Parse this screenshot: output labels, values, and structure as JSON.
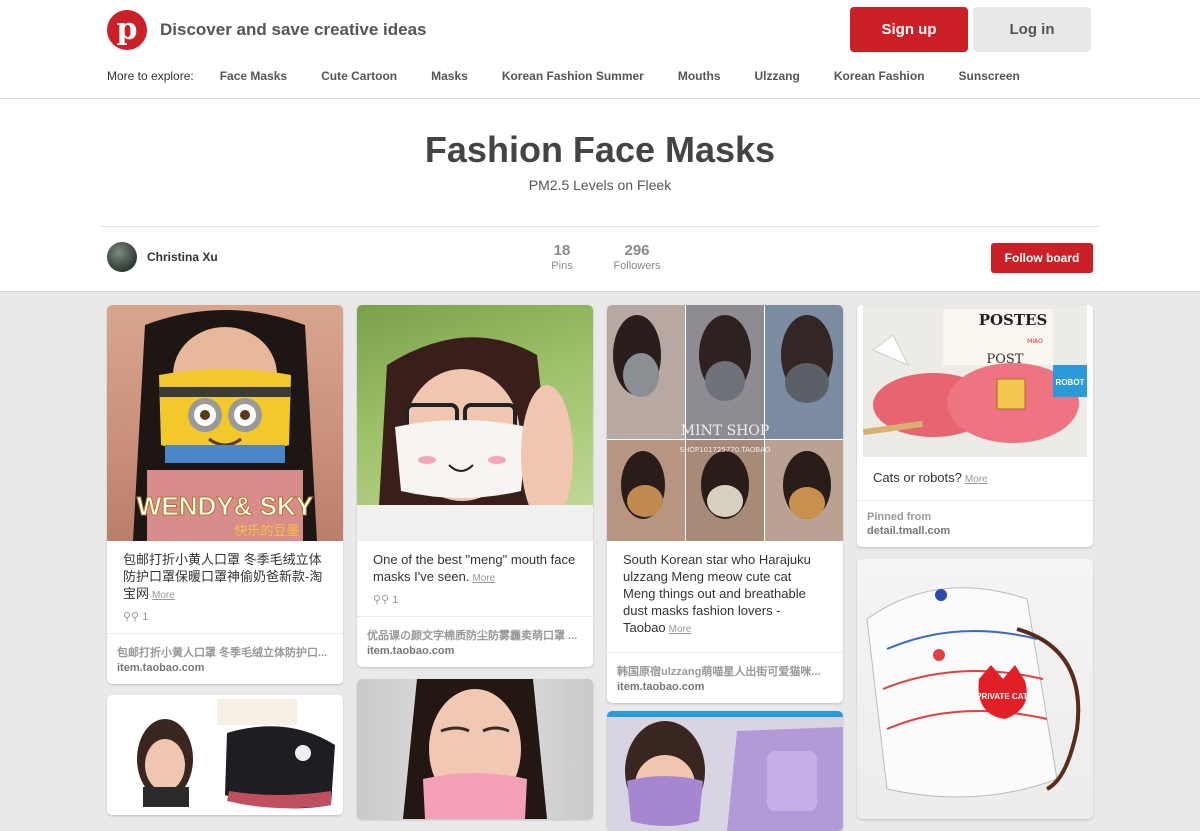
{
  "header": {
    "logo_letter": "p",
    "tagline": "Discover and save creative ideas",
    "signup_label": "Sign up",
    "login_label": "Log in",
    "explore_label": "More to explore:",
    "explore_links": [
      "Face Masks",
      "Cute Cartoon",
      "Masks",
      "Korean Fashion Summer",
      "Mouths",
      "Ulzzang",
      "Korean Fashion",
      "Sunscreen"
    ]
  },
  "board": {
    "title": "Fashion Face Masks",
    "description": "PM2.5 Levels on Fleek",
    "owner": "Christina Xu",
    "pins_count": "18",
    "pins_label": "Pins",
    "followers_count": "296",
    "followers_label": "Followers",
    "follow_label": "Follow board"
  },
  "pins": [
    {
      "description": "包邮打折小黄人口罩 冬季毛绒立体防护口罩保暖口罩神偷奶爸新款-淘宝网",
      "more": "More",
      "repins": "1",
      "source_title": "包邮打折小黄人口罩 冬季毛绒立体防护口...",
      "source_domain": "item.taobao.com",
      "image_text": "WENDY& SKY",
      "image_subtext": "快乐的豆墨"
    },
    {
      "description": "One of the best \"meng\" mouth face masks I've seen.",
      "more": "More",
      "repins": "1",
      "source_title": "优品课の颜文字棉质防尘防雾霾卖萌口罩 ...",
      "source_domain": "item.taobao.com"
    },
    {
      "description": "South Korean star who Harajuku ulzzang Meng meow cute cat Meng things out and breathable dust masks fashion lovers - Taobao",
      "more": "More",
      "source_title": "韩国原宿ulzzang萌喵星人出街可爱猫咪...",
      "source_domain": "item.taobao.com",
      "image_text": "MINT SHOP",
      "image_subtext": "SHOP101725770.TAOBAO"
    },
    {
      "description": "Cats or robots?",
      "more": "More",
      "pinned_from": "Pinned from",
      "source_domain": "detail.tmall.com",
      "image_text_1": "POSTES",
      "image_text_2": "POST",
      "image_text_3": "ROBOT",
      "image_text_4": "MIAO"
    },
    {
      "image_text": "PRIVATE CAT"
    }
  ],
  "colors": {
    "brand_red": "#cb2027",
    "background": "#e9e9e9"
  }
}
